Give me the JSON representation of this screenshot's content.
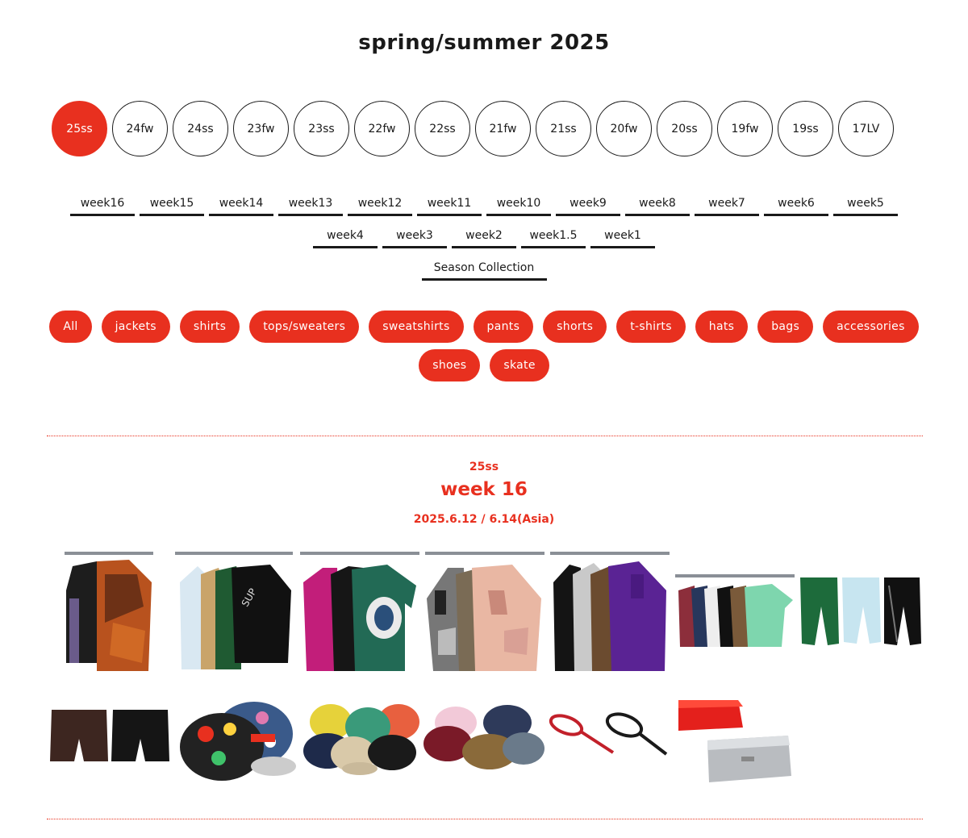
{
  "page": {
    "title": "spring/summer 2025"
  },
  "seasons": [
    "25ss",
    "24fw",
    "24ss",
    "23fw",
    "23ss",
    "22fw",
    "22ss",
    "21fw",
    "21ss",
    "20fw",
    "20ss",
    "19fw",
    "19ss",
    "17LV"
  ],
  "active_season": "25ss",
  "weeks_row1": [
    "week16",
    "week15",
    "week14",
    "week13",
    "week12",
    "week11",
    "week10",
    "week9",
    "week8",
    "week7",
    "week6",
    "week5"
  ],
  "weeks_row2": [
    "week4",
    "week3",
    "week2",
    "week1.5",
    "week1"
  ],
  "season_collection_label": "Season Collection",
  "categories_row1": [
    "All",
    "jackets",
    "shirts",
    "tops/sweaters",
    "sweatshirts",
    "pants",
    "shorts",
    "t-shirts",
    "hats",
    "bags",
    "accessories"
  ],
  "categories_row2": [
    "shoes",
    "skate"
  ],
  "drop": {
    "season": "25ss",
    "week": "week 16",
    "date": "2025.6.12 / 6.14(Asia)"
  },
  "products": [
    {
      "name": "jackets-camo-hoodie-thumbnail",
      "icon": "jacket-rack-icon"
    },
    {
      "name": "varsity-jackets-thumbnail",
      "icon": "jacket-rack-icon"
    },
    {
      "name": "shirts-thumbnail",
      "icon": "shirt-rack-icon"
    },
    {
      "name": "camo-shirts-thumbnail",
      "icon": "shirt-rack-icon"
    },
    {
      "name": "zip-hoodies-thumbnail",
      "icon": "hoodie-rack-icon"
    },
    {
      "name": "t-shirts-thumbnail",
      "icon": "tshirt-rack-icon"
    },
    {
      "name": "track-pants-thumbnail",
      "icon": "pants-icon"
    },
    {
      "name": "leather-shorts-thumbnail",
      "icon": "shorts-icon"
    },
    {
      "name": "printed-cap-thumbnail",
      "icon": "cap-icon"
    },
    {
      "name": "6-panel-caps-thumbnail",
      "icon": "cap-icon"
    },
    {
      "name": "bucket-hats-thumbnail",
      "icon": "hat-icon"
    },
    {
      "name": "tennis-rackets-thumbnail",
      "icon": "racket-icon"
    },
    {
      "name": "toolboxes-thumbnail",
      "icon": "toolbox-icon"
    }
  ],
  "colors": {
    "accent": "#e8301f",
    "text": "#1a1a1a"
  }
}
